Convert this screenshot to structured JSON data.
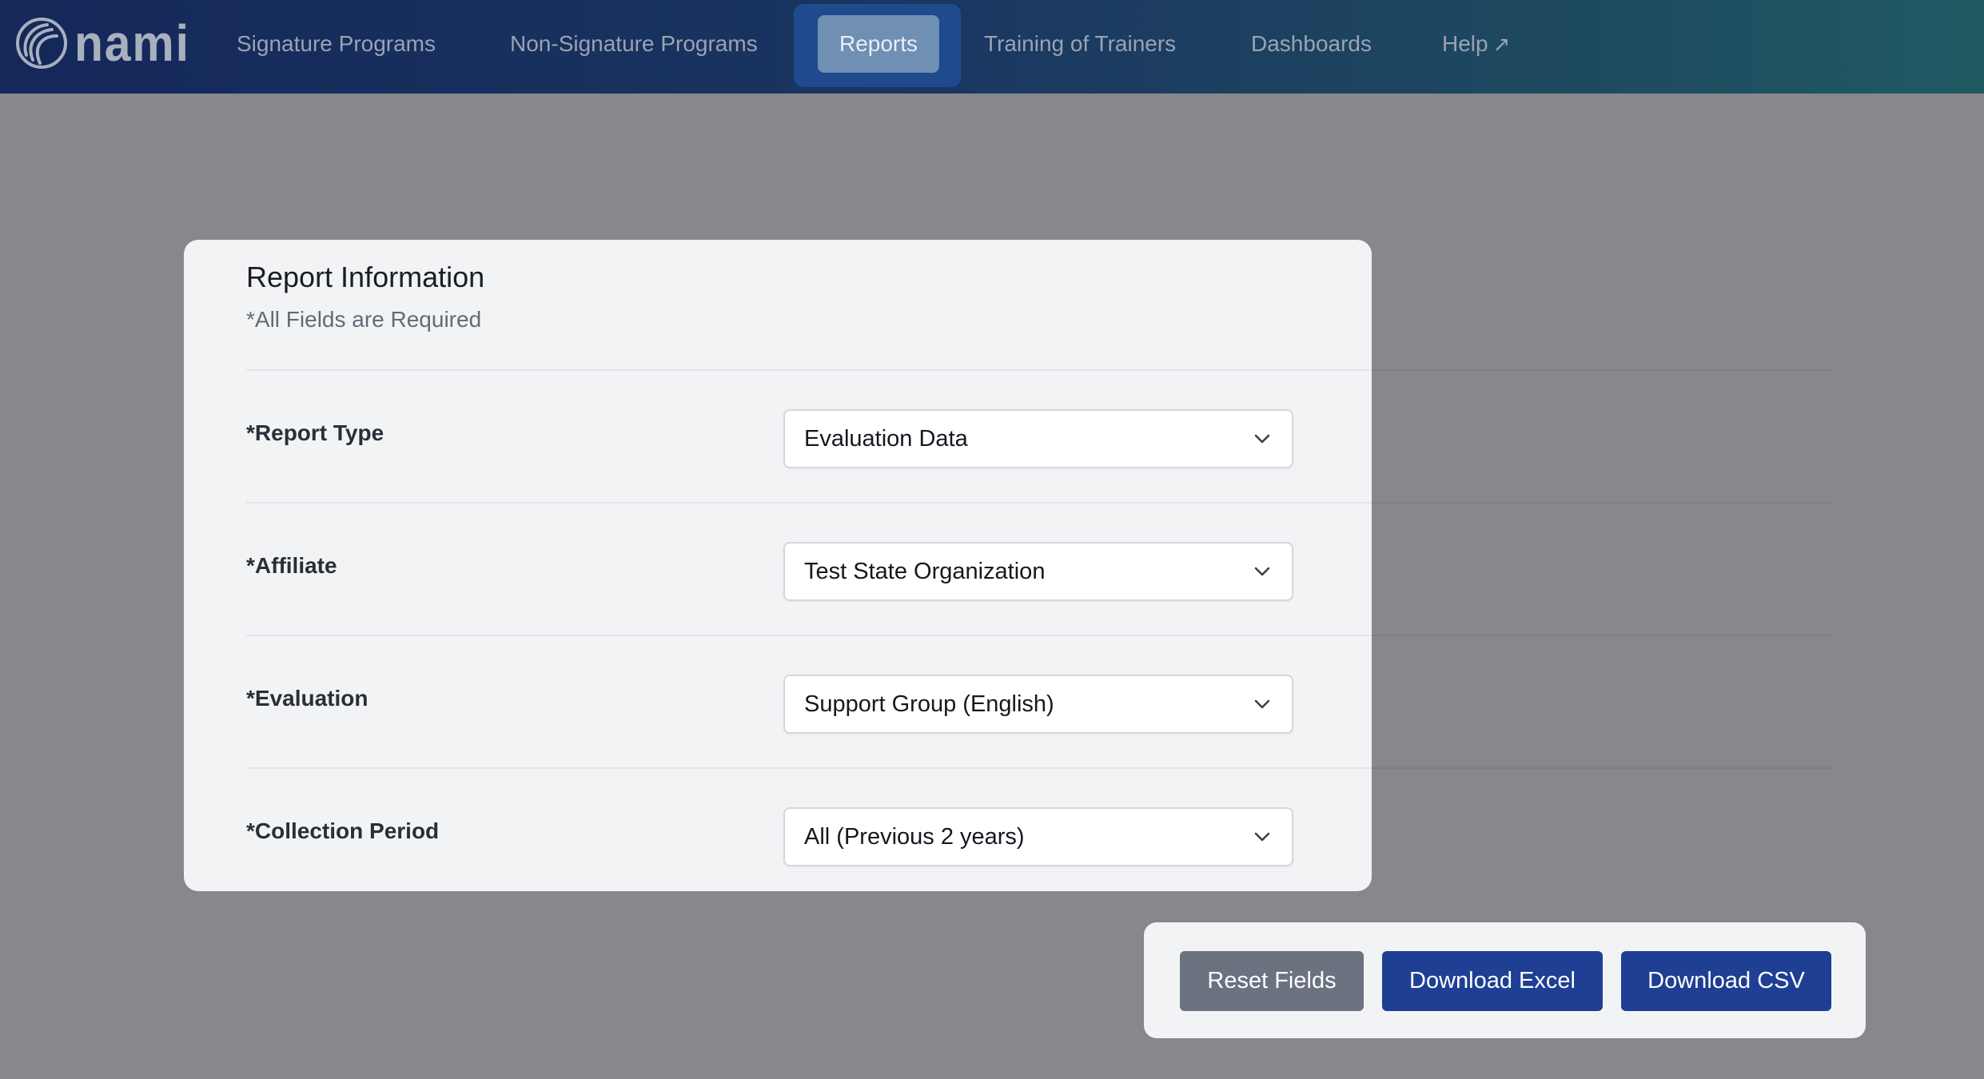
{
  "nav": {
    "logo_text": "nami",
    "items": [
      {
        "label": "Signature Programs"
      },
      {
        "label": "Non-Signature Programs"
      },
      {
        "label": "Reports"
      },
      {
        "label": "Training of Trainers"
      },
      {
        "label": "Dashboards"
      },
      {
        "label": "Help"
      }
    ],
    "active_item": "Reports",
    "help_external_icon": "arrow-up-right-icon"
  },
  "card": {
    "title": "Report Information",
    "subtitle": "*All Fields are Required",
    "fields": [
      {
        "label": "*Report Type",
        "value": "Evaluation Data"
      },
      {
        "label": "*Affiliate",
        "value": "Test State Organization"
      },
      {
        "label": "*Evaluation",
        "value": "Support Group (English)"
      },
      {
        "label": "*Collection Period",
        "value": "All (Previous 2 years)"
      }
    ]
  },
  "actions": {
    "reset_label": "Reset Fields",
    "excel_label": "Download Excel",
    "csv_label": "Download CSV"
  },
  "colors": {
    "nav_gradient_start": "#14285a",
    "nav_gradient_end": "#1f5a62",
    "active_tab_bg": "#1f4a8e",
    "active_pill_bg": "#6f8fb3",
    "overlay_bg": "#87888b",
    "card_bg": "#f2f3f5",
    "primary_button": "#1f3f94",
    "secondary_button": "#6b7280"
  }
}
